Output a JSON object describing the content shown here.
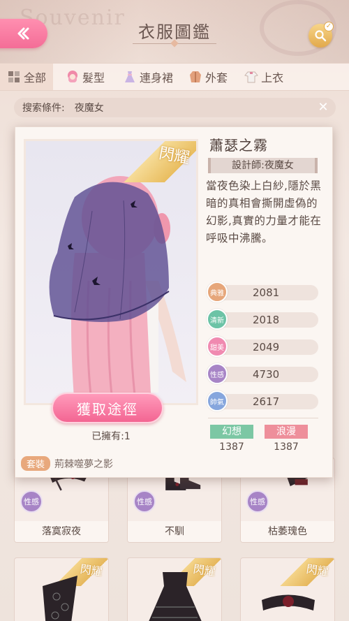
{
  "header": {
    "title": "衣服圖鑑",
    "bg_word": "Souvenir"
  },
  "tabs": [
    {
      "label": "全部",
      "icon": "grid-icon",
      "active": true
    },
    {
      "label": "髮型",
      "icon": "hair-icon",
      "active": false
    },
    {
      "label": "連身裙",
      "icon": "dress-icon",
      "active": false
    },
    {
      "label": "外套",
      "icon": "coat-icon",
      "active": false
    },
    {
      "label": "上衣",
      "icon": "top-icon",
      "active": false
    }
  ],
  "search": {
    "label": "搜索條件:",
    "value": "夜魔女"
  },
  "grid": {
    "row1": [
      {
        "name": "落寞寂夜",
        "badge": "性感"
      },
      {
        "name": "不馴",
        "badge": "性感"
      },
      {
        "name": "枯萎瑰色",
        "badge": "性感"
      }
    ],
    "row2_shine": "閃耀"
  },
  "detail": {
    "shine_label": "閃耀",
    "item_name": "蕭瑟之霧",
    "designer": "設計師:夜魔女",
    "description": "當夜色染上白紗,隱於黑暗的真相會撕開虛偽的幻影,真實的力量才能在呼吸中沸騰。",
    "get_button": "獲取途徑",
    "owned": "已擁有:1",
    "set_tag": "套裝",
    "set_name": "荊棘噬夢之影",
    "stats": [
      {
        "label": "典雅",
        "value": "2081",
        "color": "#e6a67a"
      },
      {
        "label": "清新",
        "value": "2018",
        "color": "#6cc3a6"
      },
      {
        "label": "甜美",
        "value": "2049",
        "color": "#f08ab0"
      },
      {
        "label": "性感",
        "value": "4730",
        "color": "#a784c6"
      },
      {
        "label": "帥氣",
        "value": "2617",
        "color": "#86a6dd"
      }
    ],
    "styles": [
      {
        "label": "幻想",
        "value": "1387",
        "color": "#7cc7a4"
      },
      {
        "label": "浪漫",
        "value": "1387",
        "color": "#ee8f9b"
      }
    ]
  }
}
